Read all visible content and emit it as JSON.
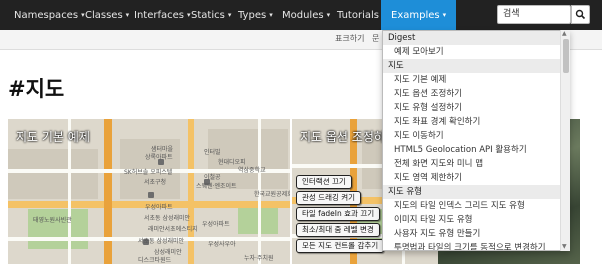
{
  "nav": {
    "items": [
      {
        "label": "Namespaces"
      },
      {
        "label": "Classes"
      },
      {
        "label": "Interfaces"
      },
      {
        "label": "Statics"
      },
      {
        "label": "Types"
      },
      {
        "label": "Modules"
      },
      {
        "label": "Tutorials"
      },
      {
        "label": "Examples"
      }
    ],
    "caret": "▾",
    "active_index": 7,
    "search": {
      "value": "검색"
    },
    "colors": {
      "bar": "#222222",
      "active": "#1e8ed8"
    }
  },
  "subbar": {
    "links": [
      {
        "label": "표크하기"
      },
      {
        "label": "문"
      }
    ]
  },
  "page": {
    "title": "#지도"
  },
  "thumbnails": [
    {
      "title": "지도 기본 예제"
    },
    {
      "title": "지도 옵션 조정하기",
      "buttons": [
        "인터랙션 끄기",
        "관성 드래깅 켜기",
        "타일 fadeIn 효과 끄기",
        "최소/최대 줌 레벨 변경",
        "모든 지도 컨트롤 감추기"
      ]
    }
  ],
  "map_labels": [
    "샘터마을",
    "상록아파트",
    "SK허브솔 오피스텔",
    "인터빌",
    "현대디오피",
    "역삼중학교",
    "서초구청",
    "이철공",
    "스웨덴·엔조이트",
    "한국교원공제회",
    "우성아파트",
    "우성아파트",
    "서초동 삼성래미안",
    "래미안서초에스티지",
    "서초동 삼성래미안",
    "태영노원사빈관",
    "우성사우아",
    "삼성래미안",
    "디스크타원드",
    "누자·주치원"
  ],
  "dropdown": {
    "sections": [
      {
        "header": "Digest",
        "items": [
          "예제 모아보기"
        ]
      },
      {
        "header": "지도",
        "items": [
          "지도 기본 예제",
          "지도 옵션 조정하기",
          "지도 유형 설정하기",
          "지도 좌표 경계 확인하기",
          "지도 이동하기",
          "HTML5 Geolocation API 활용하기",
          "전체 화면 지도와 미니 맵",
          "지도 영역 제한하기"
        ]
      },
      {
        "header": "지도 유형",
        "items": [
          "지도의 타일 인덱스 그리드 지도 유형",
          "이미지 타일 지도 유형",
          "사용자 지도 유형 만들기",
          "투명법과 타일의 크기를 동적으로 변경하기"
        ]
      }
    ]
  }
}
